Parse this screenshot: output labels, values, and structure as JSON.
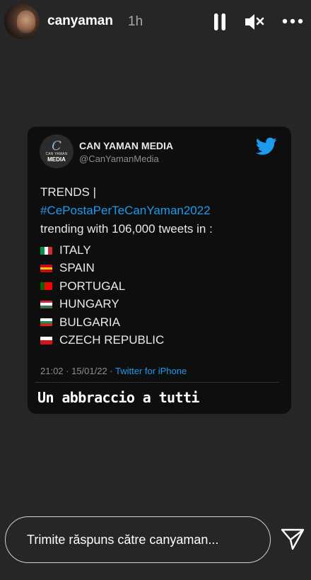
{
  "header": {
    "username": "canyaman",
    "time": "1h",
    "icons": [
      "pause-icon",
      "mute-icon",
      "more-icon"
    ]
  },
  "tweet": {
    "account_name": "CAN YAMAN MEDIA",
    "handle": "@CanYamanMedia",
    "logo_text_top": "CAN YAMAN",
    "logo_text_bottom": "MEDIA",
    "line1": "TRENDS |",
    "hashtag": "#CePostaPerTeCanYaman2022",
    "line3": "trending with 106,000 tweets in :",
    "countries": [
      {
        "name": "ITALY",
        "colors": [
          "#009246",
          "#ffffff",
          "#ce2b37"
        ],
        "orient": "v"
      },
      {
        "name": "SPAIN",
        "colors": [
          "#c60b1e",
          "#ffc400",
          "#c60b1e"
        ],
        "orient": "h"
      },
      {
        "name": "PORTUGAL",
        "colors": [
          "#006600",
          "#ff0000",
          "#ff0000"
        ],
        "orient": "v"
      },
      {
        "name": "HUNGARY",
        "colors": [
          "#ce2939",
          "#ffffff",
          "#477050"
        ],
        "orient": "h"
      },
      {
        "name": "BULGARIA",
        "colors": [
          "#ffffff",
          "#00966e",
          "#d62612"
        ],
        "orient": "h"
      },
      {
        "name": "CZECH REPUBLIC",
        "colors": [
          "#ffffff",
          "#d7141a"
        ],
        "orient": "h"
      }
    ],
    "timestamp": "21:02 · 15/01/22 · ",
    "source": "Twitter for iPhone",
    "accent": "#1d9bf0"
  },
  "caption": "Un abbraccio a tutti",
  "reply": {
    "placeholder": "Trimite răspuns către canyaman..."
  }
}
